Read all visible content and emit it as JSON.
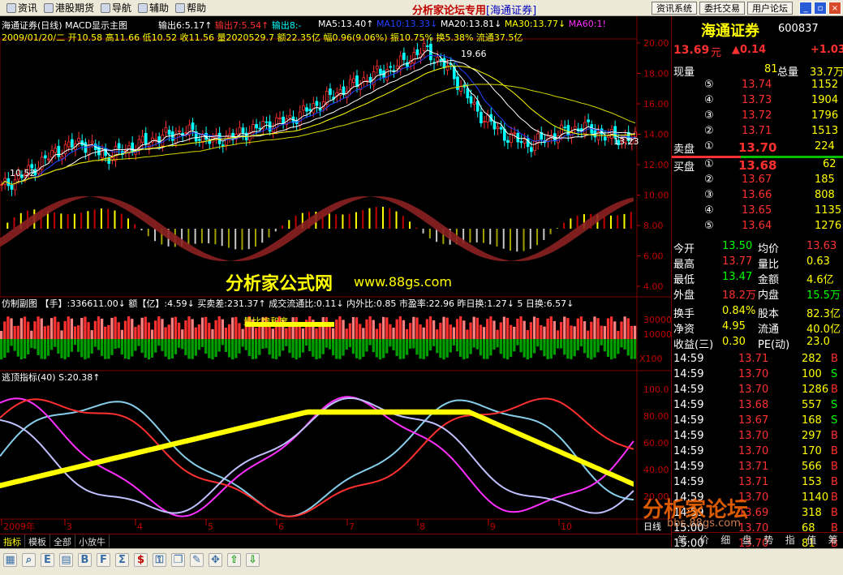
{
  "menu": {
    "items": [
      {
        "label": "资讯"
      },
      {
        "label": "港股期货"
      },
      {
        "label": "导航"
      },
      {
        "label": "辅助"
      },
      {
        "label": "帮助"
      }
    ],
    "brand": "分析家论坛专用",
    "brand_sub": "[海通证券]",
    "buttons": [
      "资讯系统",
      "委托交易",
      "用户论坛"
    ]
  },
  "chart": {
    "title_line": "海通证券(日线) MACD显示主图",
    "out_indicators": [
      {
        "text": "输出6:5.17↑",
        "color": "#ffffff"
      },
      {
        "text": "输出7:5.54↑",
        "color": "#ff3030"
      },
      {
        "text": "输出8:-",
        "color": "#00ffff"
      }
    ],
    "ma": [
      {
        "text": "MA5:13.40↑",
        "color": "#ffffff"
      },
      {
        "text": "MA10:13.33↓",
        "color": "#2040ff"
      },
      {
        "text": "MA20:13.81↓",
        "color": "#ffffff"
      },
      {
        "text": "MA30:13.77↓",
        "color": "#ffff00"
      },
      {
        "text": "MA60:1!",
        "color": "#ff30ff"
      }
    ],
    "info_line": "2009/01/20/二 开10.58 高11.66 低10.52 收11.56 量2020529.7 额22.35亿 幅0.96(9.06%) 振10.75% 换5.38% 流通37.5亿",
    "price_axis": [
      "20.00",
      "18.00",
      "16.00",
      "14.00",
      "12.00",
      "10.00",
      "8.00",
      "6.00",
      "4.00"
    ],
    "annot_high": "19.66",
    "annot_low": "10.52",
    "annot_last": "13.23",
    "watermark": "分析家公式网",
    "watermark_url": "www.88gs.com",
    "sub1_line": "仿制副图 【手】:336611.00↓ 额【亿】:4.59↓ 买卖差:231.37↑ 成交流通比:0.11↓ 内外比:0.85 市盈率:22.96 昨日换:1.27↓ 5 日换:6.57↓",
    "sub1_label": "量比饱和度",
    "sub1_axis": [
      "30000",
      "10000",
      "X100"
    ],
    "sub2_line": "逃顶指标(40) S:20.38↑",
    "sub2_axis": [
      "100.0",
      "80.00",
      "60.00",
      "40.00",
      "20.00"
    ],
    "dates": [
      "2009年",
      "3",
      "4",
      "5",
      "6",
      "7",
      "8",
      "9",
      "10"
    ],
    "date_label": "日线"
  },
  "tabs": [
    "指标",
    "模板",
    "全部",
    "小放牛"
  ],
  "stock": {
    "name": "海通证券",
    "code": "600837",
    "price": "13.69",
    "price_unit": "元",
    "change": "▲0.14",
    "change_pct": "+1.03",
    "now_hand_label": "现量",
    "now_hand": "81",
    "total_label": "总量",
    "total": "33.7万",
    "sell": [
      {
        "lvl": "⑤",
        "p": "13.74",
        "v": "1152"
      },
      {
        "lvl": "④",
        "p": "13.73",
        "v": "1904"
      },
      {
        "lvl": "③",
        "p": "13.72",
        "v": "1796"
      },
      {
        "lvl": "②",
        "p": "13.71",
        "v": "1513"
      },
      {
        "lvl": "①",
        "p": "13.70",
        "v": "224"
      }
    ],
    "sell_label": "卖盘",
    "buy_label": "买盘",
    "buy": [
      {
        "lvl": "①",
        "p": "13.68",
        "v": "62"
      },
      {
        "lvl": "②",
        "p": "13.67",
        "v": "185"
      },
      {
        "lvl": "③",
        "p": "13.66",
        "v": "808"
      },
      {
        "lvl": "④",
        "p": "13.65",
        "v": "1135"
      },
      {
        "lvl": "⑤",
        "p": "13.64",
        "v": "1276"
      }
    ],
    "stats": [
      {
        "l1": "今开",
        "v1": "13.50",
        "c1": "#00ff00",
        "l2": "均价",
        "v2": "13.63",
        "c2": "#ff3030"
      },
      {
        "l1": "最高",
        "v1": "13.77",
        "c1": "#ff3030",
        "l2": "量比",
        "v2": "0.63",
        "c2": "#ffff00"
      },
      {
        "l1": "最低",
        "v1": "13.47",
        "c1": "#00ff00",
        "l2": "金额",
        "v2": "4.6亿",
        "c2": "#ffff00"
      },
      {
        "l1": "外盘",
        "v1": "18.2万",
        "c1": "#ff3030",
        "l2": "内盘",
        "v2": "15.5万",
        "c2": "#00ff00"
      },
      {
        "l1": "换手",
        "v1": "0.84%",
        "c1": "#ffff00",
        "l2": "股本",
        "v2": "82.3亿",
        "c2": "#ffff00"
      },
      {
        "l1": "净资",
        "v1": "4.95",
        "c1": "#ffff00",
        "l2": "流通",
        "v2": "40.0亿",
        "c2": "#ffff00"
      },
      {
        "l1": "收益(三)",
        "v1": "0.30",
        "c1": "#ffff00",
        "l2": "PE(动)",
        "v2": "23.0",
        "c2": "#ffff00"
      }
    ],
    "ticks": [
      {
        "t": "14:59",
        "p": "13.71",
        "v": "282",
        "bs": "B"
      },
      {
        "t": "14:59",
        "p": "13.70",
        "v": "100",
        "bs": "S"
      },
      {
        "t": "14:59",
        "p": "13.70",
        "v": "1286",
        "bs": "B"
      },
      {
        "t": "14:59",
        "p": "13.68",
        "v": "557",
        "bs": "S"
      },
      {
        "t": "14:59",
        "p": "13.67",
        "v": "168",
        "bs": "S"
      },
      {
        "t": "14:59",
        "p": "13.70",
        "v": "297",
        "bs": "B"
      },
      {
        "t": "14:59",
        "p": "13.70",
        "v": "170",
        "bs": "B"
      },
      {
        "t": "14:59",
        "p": "13.71",
        "v": "566",
        "bs": "B"
      },
      {
        "t": "14:59",
        "p": "13.71",
        "v": "153",
        "bs": "B"
      },
      {
        "t": "14:59",
        "p": "13.70",
        "v": "1140",
        "bs": "B"
      },
      {
        "t": "14:59",
        "p": "13.69",
        "v": "318",
        "bs": "B"
      },
      {
        "t": "15:00",
        "p": "13.70",
        "v": "68",
        "bs": "B"
      },
      {
        "t": "15:00",
        "p": "13.70",
        "v": "81",
        "bs": "B"
      }
    ],
    "rtabs": [
      "笔",
      "价",
      "细",
      "盘",
      "势",
      "指",
      "值",
      "筹"
    ],
    "logo": "分析家论坛",
    "logo_url": "bbs.88gs.com"
  },
  "chart_data": {
    "type": "line",
    "title": "海通证券(日线)",
    "x_range": [
      "2009-01",
      "2009-10"
    ],
    "ylim": [
      4,
      20
    ],
    "close_series_approx": [
      10.5,
      11.5,
      12.8,
      13.5,
      12.5,
      13.2,
      13.8,
      14.2,
      13.5,
      14.0,
      14.6,
      15.0,
      16.0,
      17.0,
      17.8,
      18.5,
      19.6,
      18.2,
      15.5,
      14.0,
      13.3,
      14.0,
      14.5,
      13.8,
      13.7
    ]
  }
}
